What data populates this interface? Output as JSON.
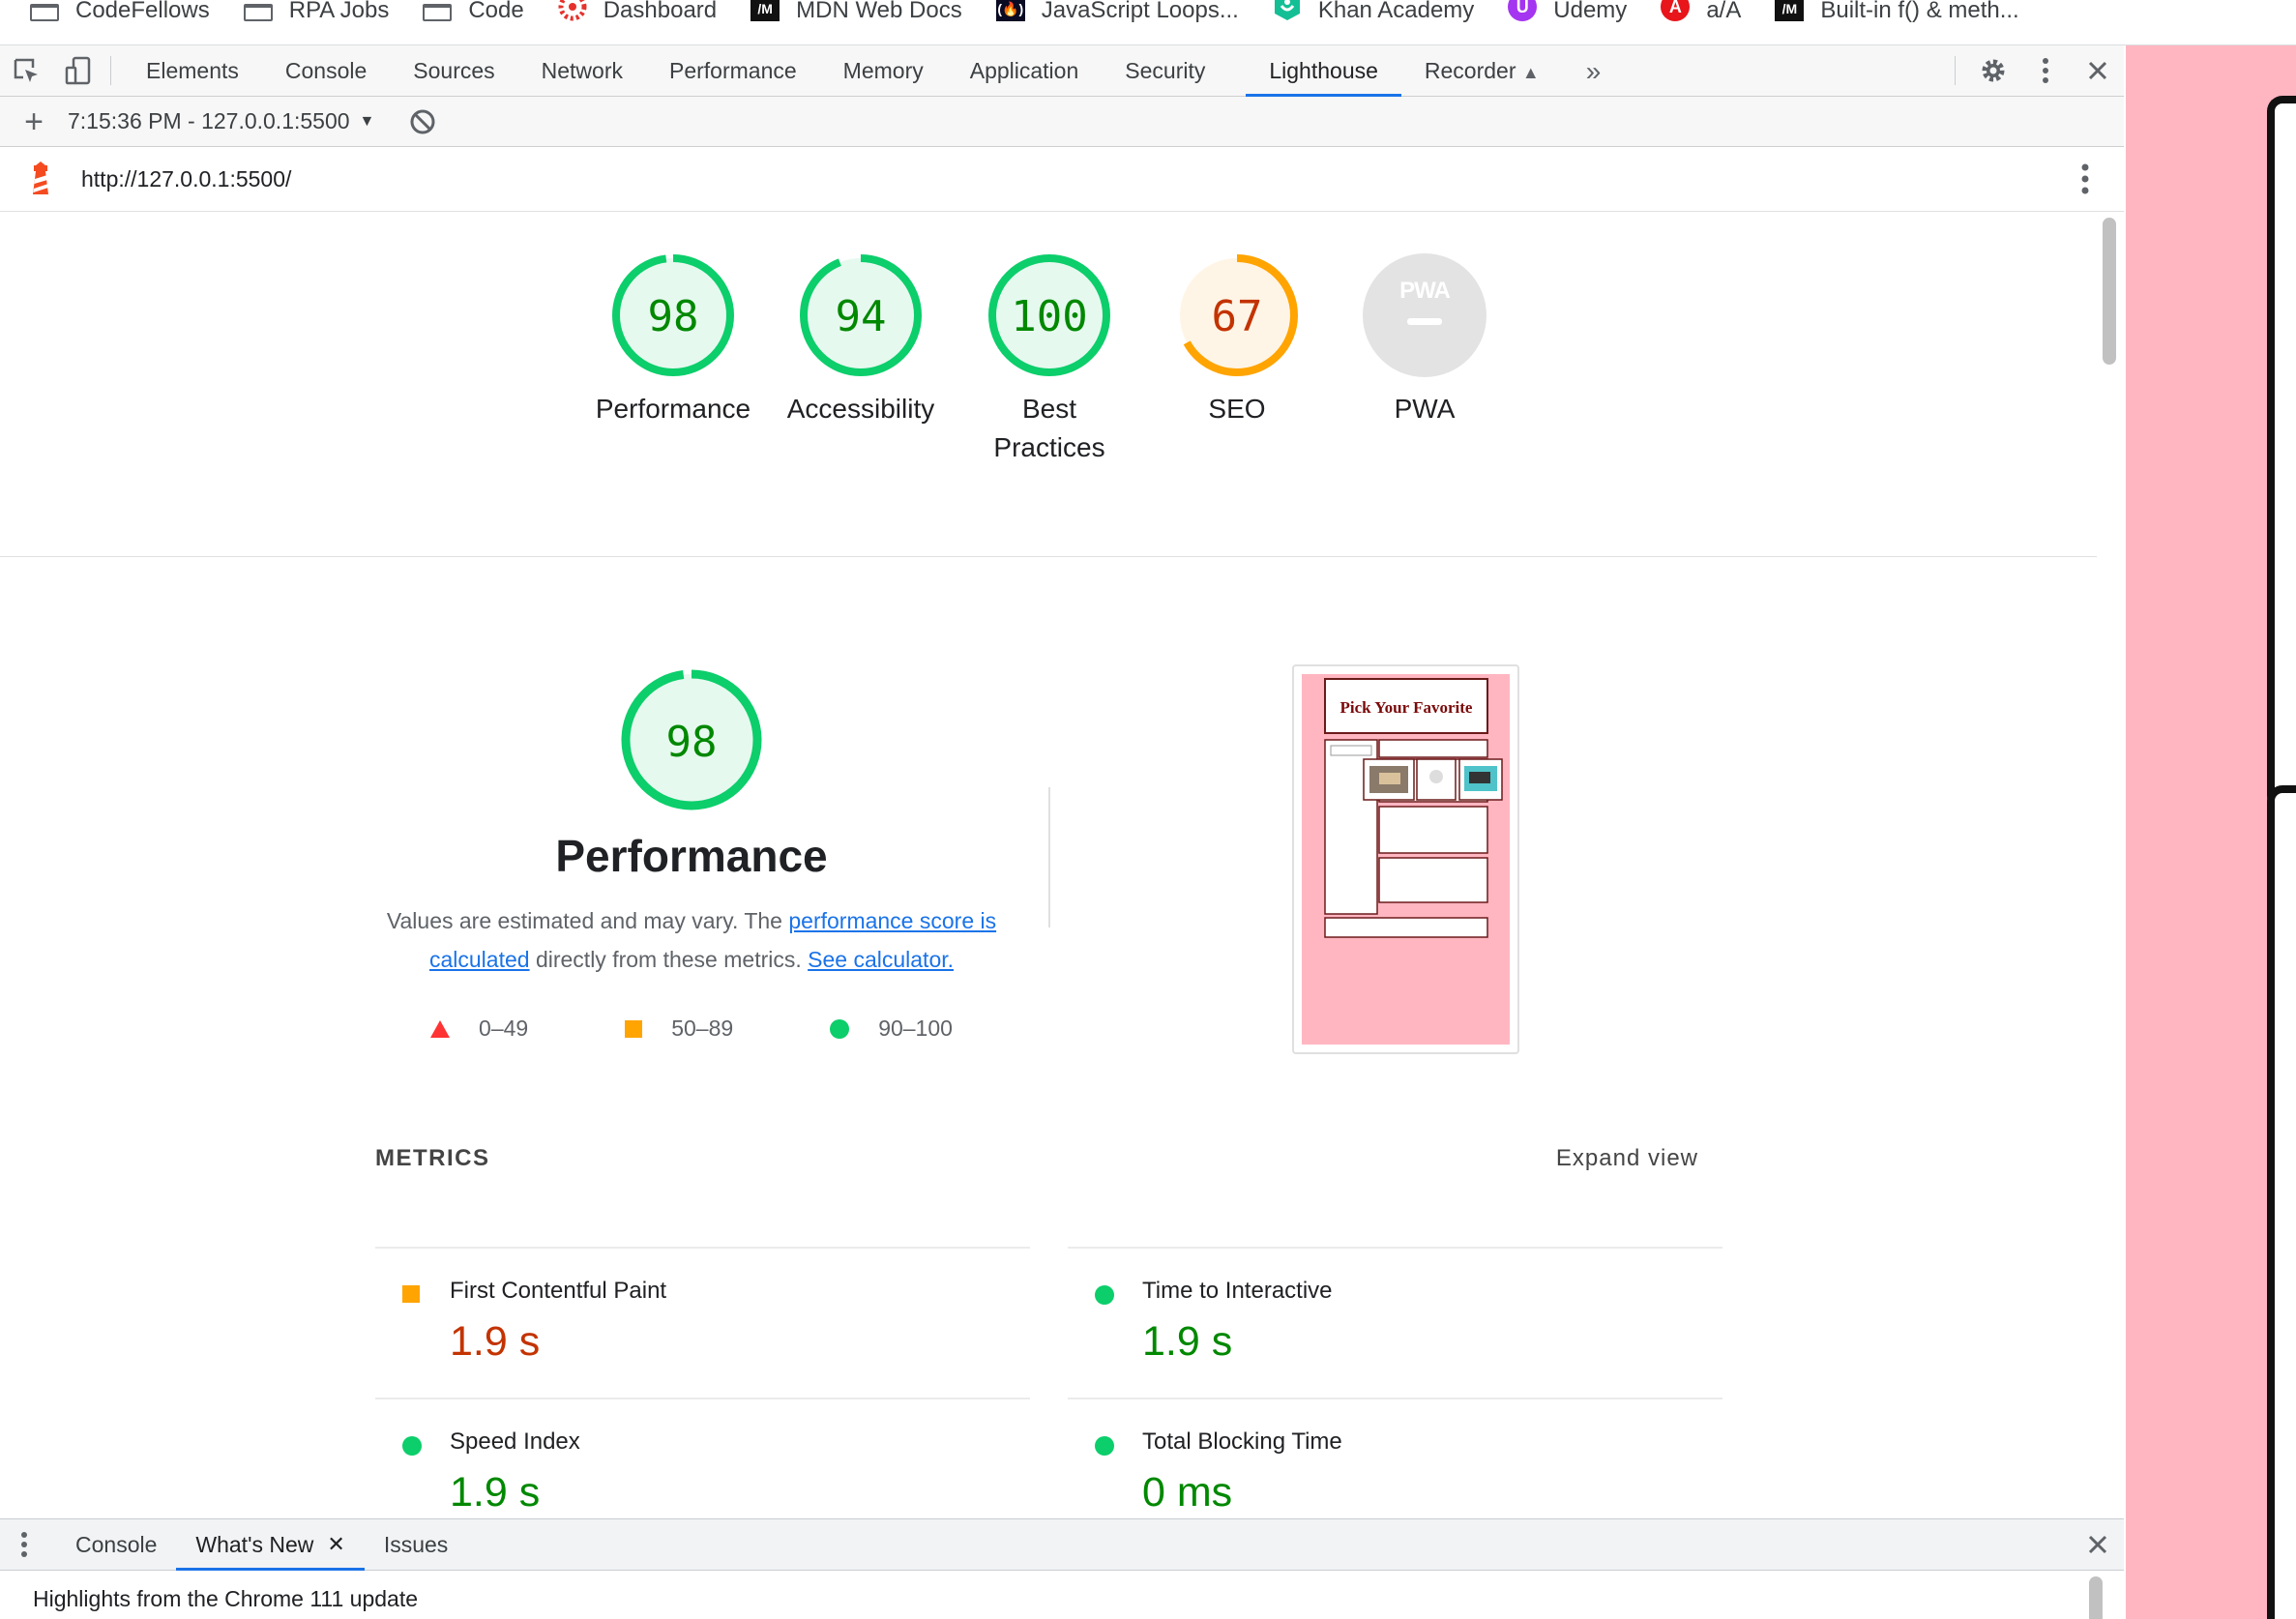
{
  "bookmarks": [
    {
      "label": "CodeFellows",
      "icon": "folder-icon"
    },
    {
      "label": "RPA Jobs",
      "icon": "folder-icon"
    },
    {
      "label": "Code",
      "icon": "folder-icon"
    },
    {
      "label": "Dashboard",
      "icon": "canvas-icon"
    },
    {
      "label": "MDN Web Docs",
      "icon": "mdn-icon"
    },
    {
      "label": "JavaScript Loops...",
      "icon": "freecodecamp-icon"
    },
    {
      "label": "Khan Academy",
      "icon": "khan-icon"
    },
    {
      "label": "Udemy",
      "icon": "udemy-icon"
    },
    {
      "label": "a/A",
      "icon": "appacademy-icon"
    },
    {
      "label": "Built-in f() & meth...",
      "icon": "mdn-icon"
    }
  ],
  "devtools": {
    "tabs": [
      "Elements",
      "Console",
      "Sources",
      "Network",
      "Performance",
      "Memory",
      "Application",
      "Security",
      "Lighthouse",
      "Recorder"
    ],
    "active_tab": "Lighthouse",
    "more_tabs_glyph": "»",
    "report_selector": "7:15:36 PM - 127.0.0.1:5500",
    "url": "http://127.0.0.1:5500/"
  },
  "gauges": [
    {
      "score": "98",
      "label": "Performance",
      "status": "pass",
      "fraction": 0.98
    },
    {
      "score": "94",
      "label": "Accessibility",
      "status": "pass",
      "fraction": 0.94
    },
    {
      "score": "100",
      "label": "Best Practices",
      "status": "pass",
      "fraction": 1.0
    },
    {
      "score": "67",
      "label": "SEO",
      "status": "average",
      "fraction": 0.67
    },
    {
      "score": "",
      "label": "PWA",
      "status": "na",
      "fraction": 0,
      "badge": "PWA"
    }
  ],
  "performance": {
    "score": "98",
    "fraction": 0.98,
    "title": "Performance",
    "desc_prefix": "Values are estimated and may vary. The ",
    "desc_link1": "performance score is calculated",
    "desc_middle": " directly from these metrics. ",
    "desc_link2": "See calculator.",
    "legend": [
      {
        "range": "0–49",
        "shape": "triangle",
        "color": "#f33"
      },
      {
        "range": "50–89",
        "shape": "square",
        "color": "#ffa400"
      },
      {
        "range": "90–100",
        "shape": "circle",
        "color": "#0cce6b"
      }
    ]
  },
  "thumbnail": {
    "heading": "Pick Your Favorite"
  },
  "metrics": {
    "title": "METRICS",
    "expand_label": "Expand view",
    "items": [
      {
        "name": "First Contentful Paint",
        "value": "1.9 s",
        "status": "average"
      },
      {
        "name": "Time to Interactive",
        "value": "1.9 s",
        "status": "pass"
      },
      {
        "name": "Speed Index",
        "value": "1.9 s",
        "status": "pass"
      },
      {
        "name": "Total Blocking Time",
        "value": "0 ms",
        "status": "pass"
      }
    ]
  },
  "drawer": {
    "tabs": [
      "Console",
      "What's New",
      "Issues"
    ],
    "active_tab": "What's New",
    "highlight": "Highlights from the Chrome 111 update"
  },
  "colors": {
    "pass": "#008800",
    "pass_ring": "#0cce6b",
    "pass_bg": "#e6f9ef",
    "average_text": "#c33300",
    "average_ring": "#ffa400",
    "average_bg": "#fff5e6",
    "na_bg": "#e8e8e8",
    "link": "#1a73e8",
    "preview_bg": "#ffb6c1"
  }
}
